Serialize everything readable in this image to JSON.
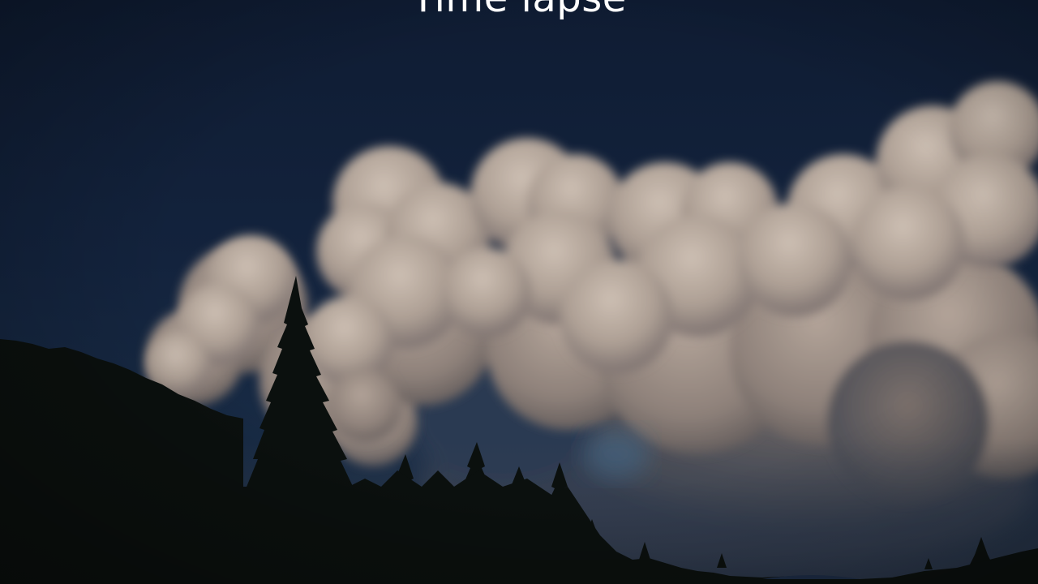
{
  "caption": {
    "text": "Time lapse"
  },
  "colors": {
    "sky_top": "#0f1c33",
    "sky_bottom": "#1a2e46",
    "smoke_light": "#c2b3a6",
    "smoke_mid": "#9d8f84",
    "smoke_shadow": "#5f5a58",
    "forest": "#0b100e"
  },
  "icons": [
    "smoke-plume",
    "conifer-forest"
  ]
}
